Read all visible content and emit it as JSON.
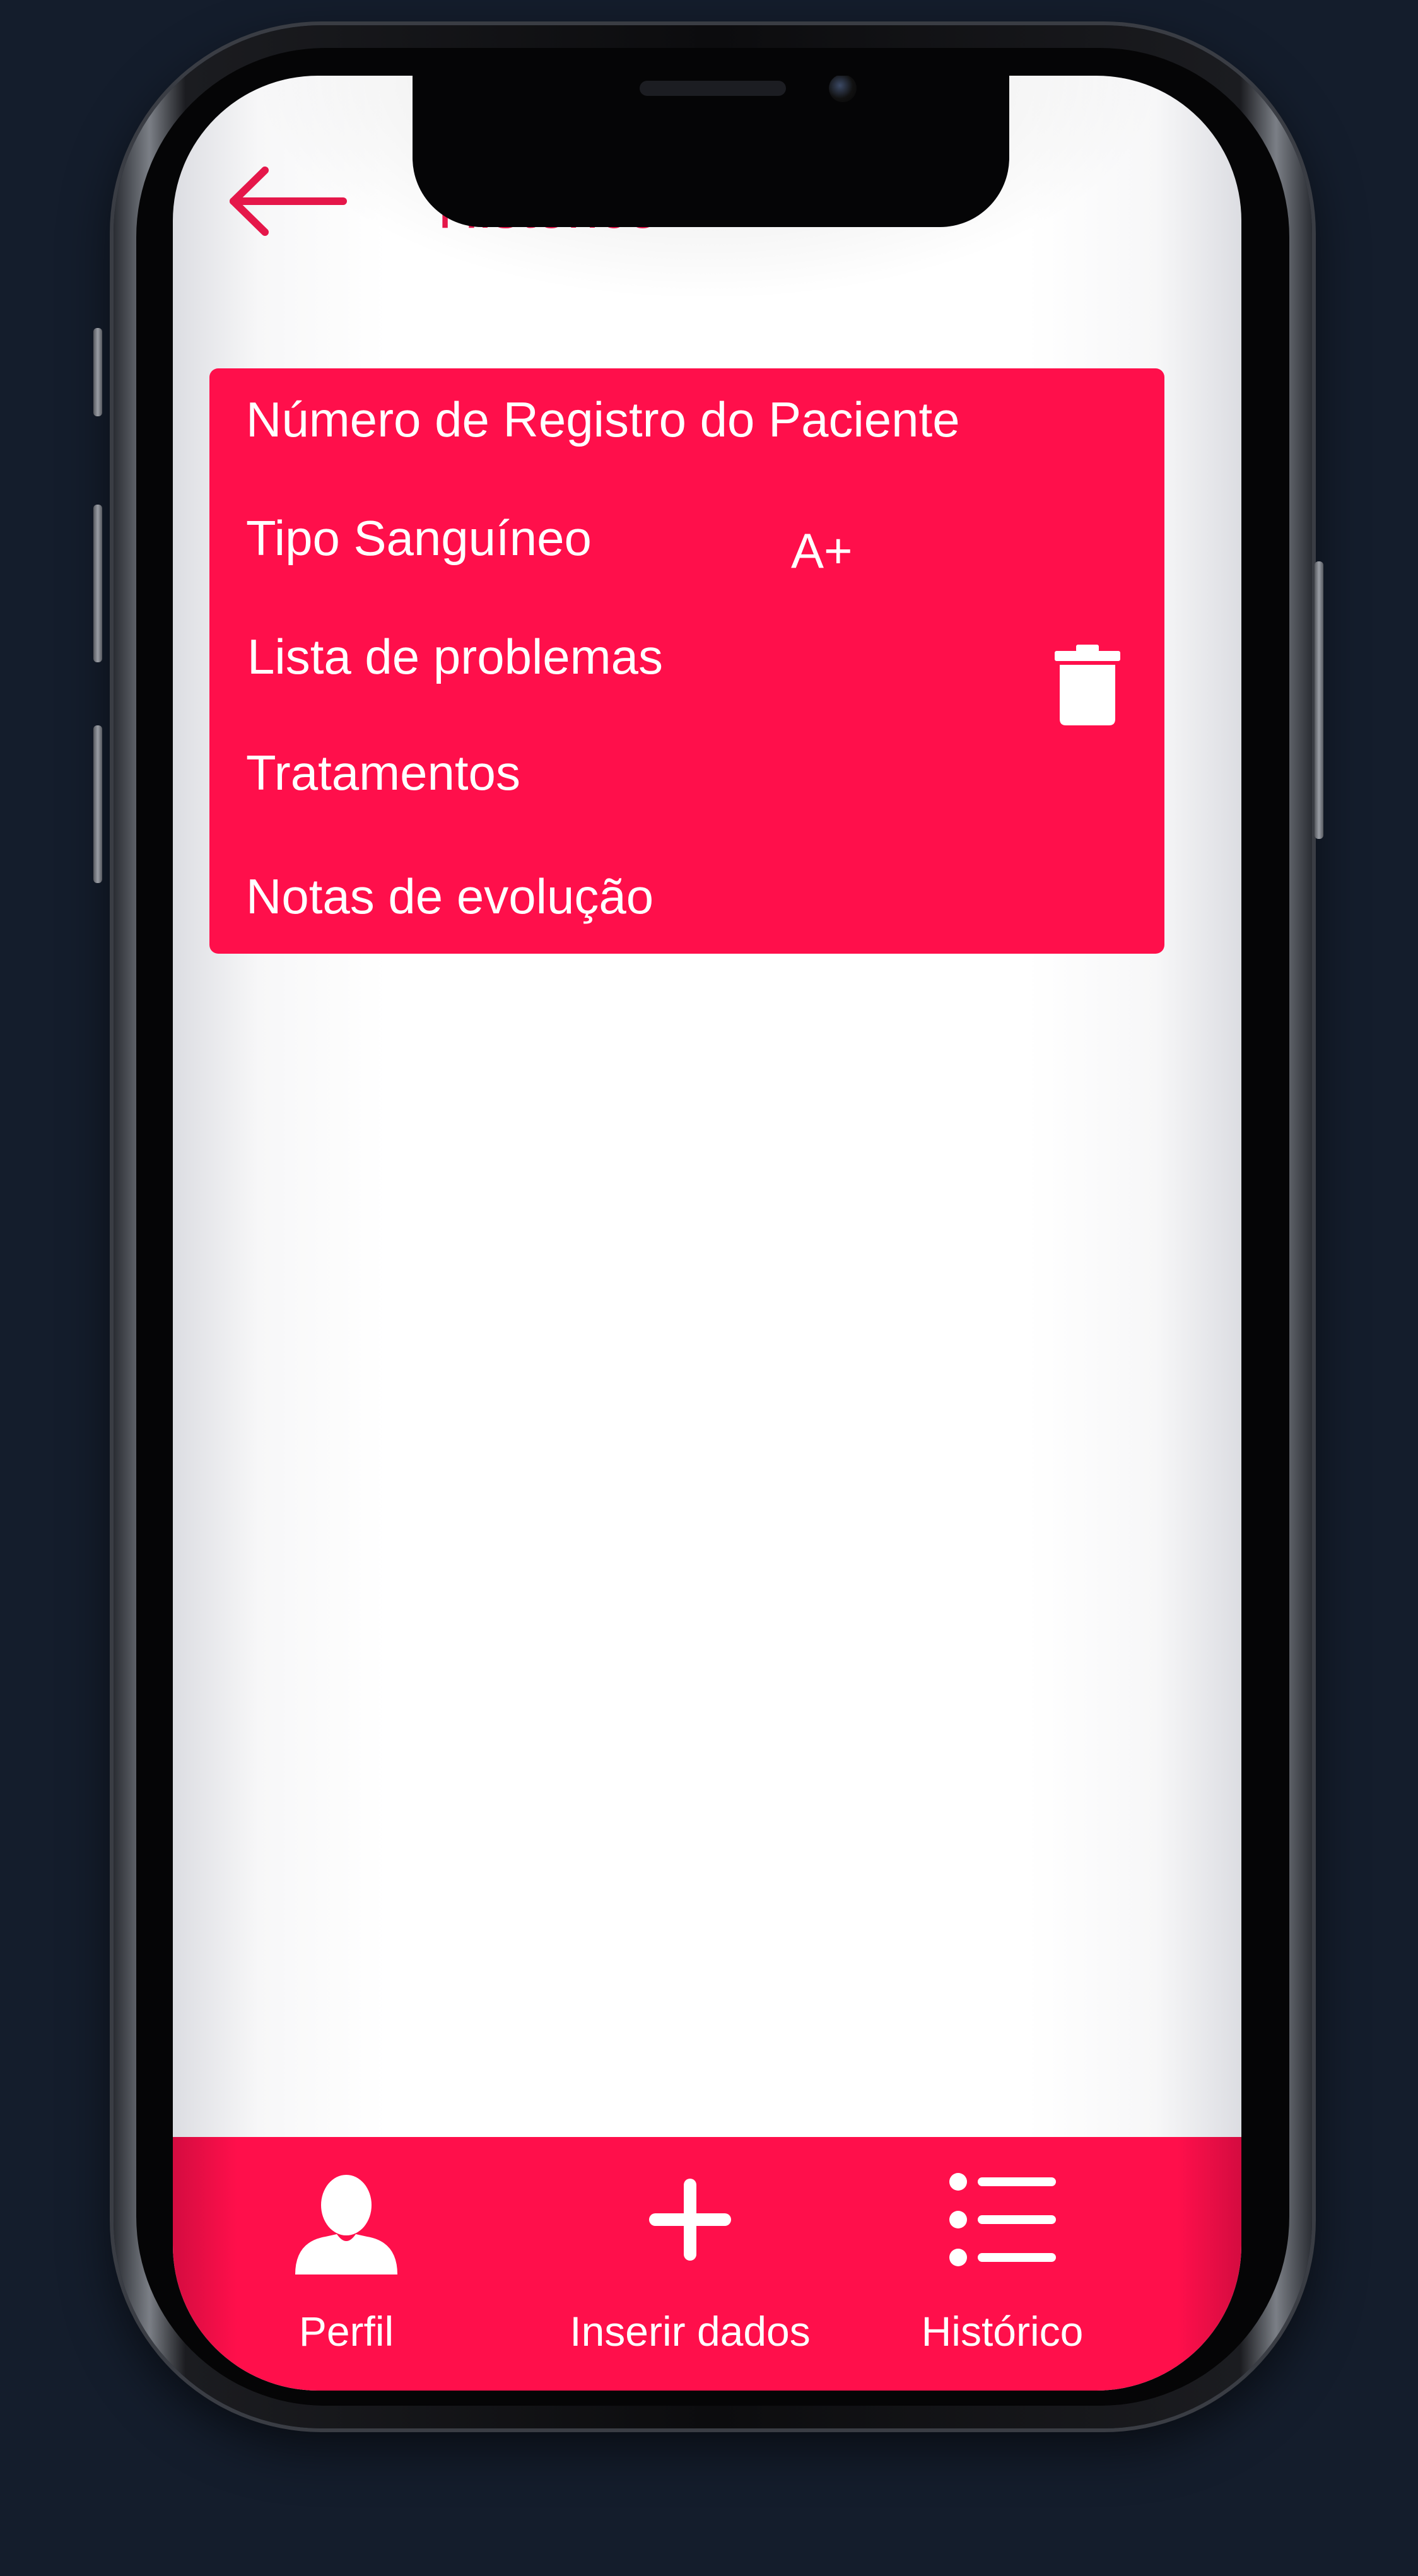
{
  "header": {
    "title": "Histórico",
    "back_icon": "arrow-left-icon"
  },
  "record": {
    "fields": [
      {
        "label": "Número de Registro do Paciente"
      },
      {
        "label": "Tipo Sanguíneo",
        "value": "A+"
      },
      {
        "label": "Lista de problemas"
      },
      {
        "label": "Tratamentos"
      },
      {
        "label": "Notas de evolução"
      }
    ],
    "delete_icon": "trash-icon"
  },
  "bottom_nav": {
    "items": [
      {
        "label": "Perfil",
        "icon": "person-icon"
      },
      {
        "label": "Inserir dados",
        "icon": "plus-icon"
      },
      {
        "label": "Histórico",
        "icon": "list-icon"
      }
    ]
  },
  "colors": {
    "accent": "#ff0f4b",
    "title": "#e5174a",
    "background": "#ffffff",
    "text_on_accent": "#ffffff"
  }
}
